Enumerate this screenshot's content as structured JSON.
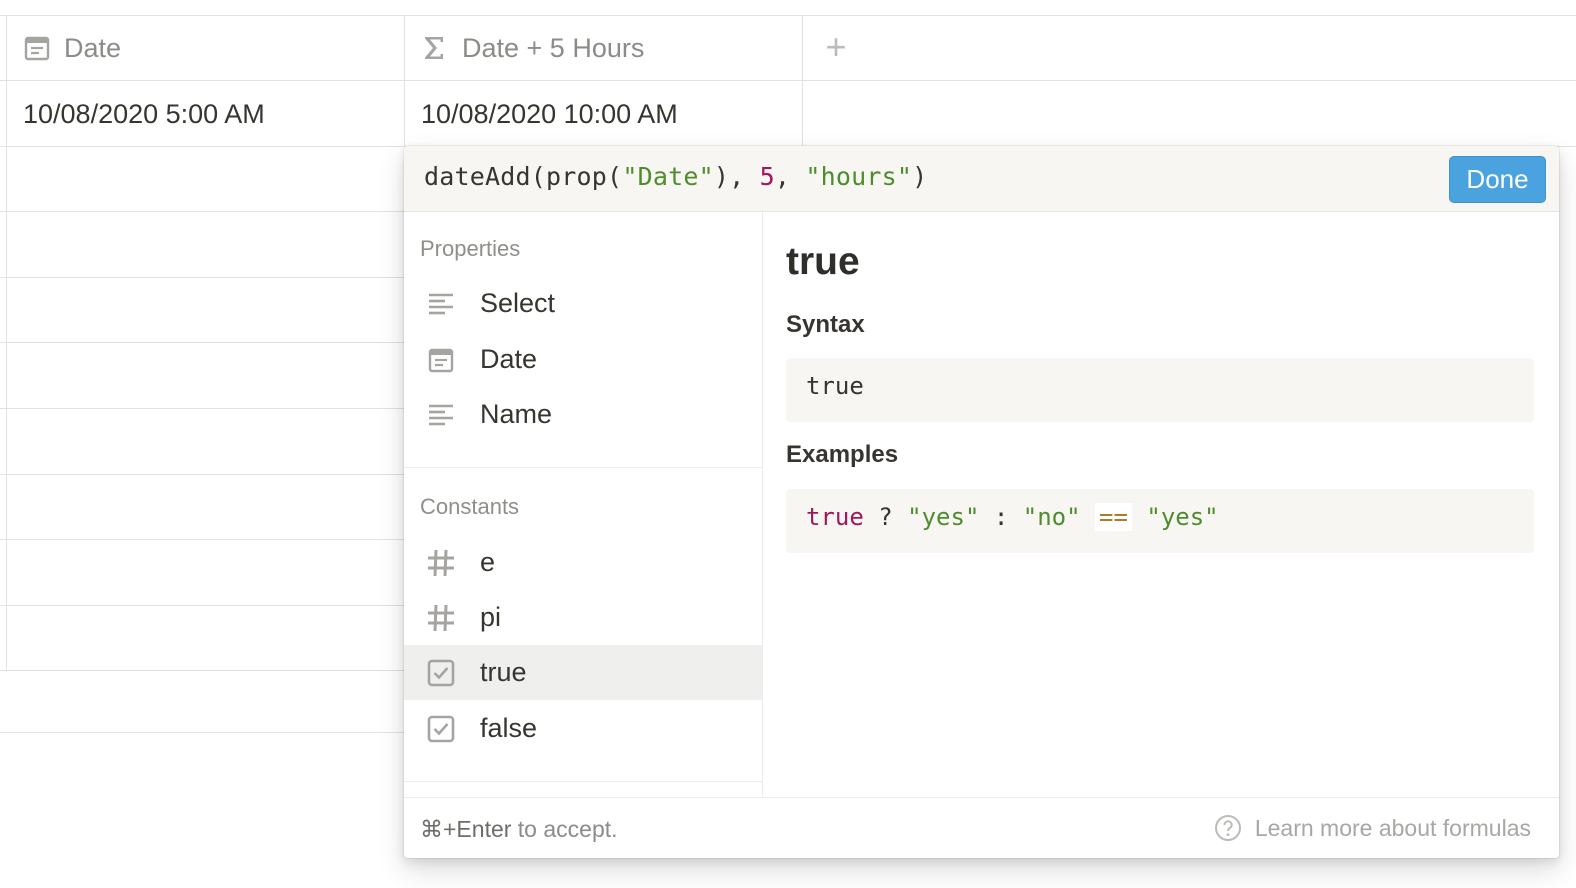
{
  "table": {
    "columns": [
      {
        "icon": "calendar-icon",
        "label": "Date"
      },
      {
        "icon": "sigma-icon",
        "label": "Date + 5 Hours"
      }
    ],
    "add_column_symbol": "+",
    "rows": [
      {
        "date": "10/08/2020 5:00 AM",
        "date_plus": "10/08/2020 10:00 AM"
      }
    ]
  },
  "popup": {
    "formula": {
      "fn": "dateAdd",
      "open1": "(",
      "prop": "prop",
      "open2": "(",
      "arg_date": "\"Date\"",
      "close_sep": "), ",
      "arg_num": "5",
      "sep": ", ",
      "arg_unit": "\"hours\"",
      "close": ")"
    },
    "done_label": "Done",
    "properties_title": "Properties",
    "properties": [
      {
        "icon": "text-lines-icon",
        "label": "Select"
      },
      {
        "icon": "calendar-icon",
        "label": "Date"
      },
      {
        "icon": "text-lines-icon",
        "label": "Name"
      }
    ],
    "constants_title": "Constants",
    "constants": [
      {
        "icon": "hash-icon",
        "label": "e"
      },
      {
        "icon": "hash-icon",
        "label": "pi"
      },
      {
        "icon": "checkbox-icon",
        "label": "true",
        "selected": true
      },
      {
        "icon": "checkbox-icon",
        "label": "false"
      }
    ],
    "doc": {
      "title": "true",
      "syntax_heading": "Syntax",
      "syntax": "true",
      "examples_heading": "Examples",
      "example": {
        "kw": "true",
        "q": " ? ",
        "s1": "\"yes\"",
        "colon": " : ",
        "s2": "\"no\"",
        "sp1": " ",
        "eq": "==",
        "sp2": " ",
        "s3": "\"yes\""
      }
    },
    "footer": {
      "shortcut": "⌘+Enter",
      "shortcut_suffix": " to accept.",
      "learn_more": "Learn more about formulas"
    }
  },
  "colors": {
    "done_button": "#4aa3df",
    "string_token": "#4d8d2c",
    "keyword_token": "#a0185c",
    "selected_row": "#efefee"
  }
}
